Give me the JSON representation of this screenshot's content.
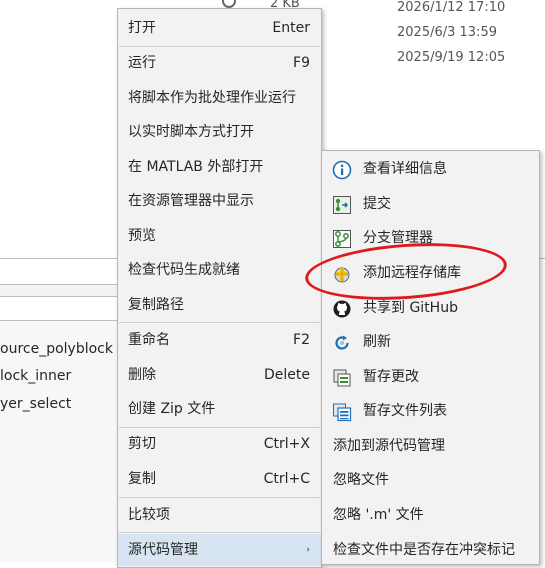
{
  "background": {
    "size_text": "2 KB",
    "dates": [
      "2026/1/12 17:10",
      "2025/6/3 13:59",
      "2025/9/19 12:05"
    ],
    "files": [
      "ource_polyblock",
      "lock_inner",
      "yer_select"
    ]
  },
  "context_menu": {
    "items": [
      {
        "label": "打开",
        "shortcut": "Enter"
      },
      {
        "label": "运行",
        "shortcut": "F9"
      },
      {
        "label": "将脚本作为批处理作业运行",
        "shortcut": ""
      },
      {
        "label": "以实时脚本方式打开",
        "shortcut": ""
      },
      {
        "label": "在 MATLAB 外部打开",
        "shortcut": ""
      },
      {
        "label": "在资源管理器中显示",
        "shortcut": ""
      },
      {
        "label": "预览",
        "shortcut": ""
      },
      {
        "label": "检查代码生成就绪",
        "shortcut": ""
      },
      {
        "label": "复制路径",
        "shortcut": ""
      },
      {
        "label": "重命名",
        "shortcut": "F2"
      },
      {
        "label": "删除",
        "shortcut": "Delete"
      },
      {
        "label": "创建 Zip 文件",
        "shortcut": ""
      },
      {
        "label": "剪切",
        "shortcut": "Ctrl+X"
      },
      {
        "label": "复制",
        "shortcut": "Ctrl+C"
      },
      {
        "label": "比较项",
        "shortcut": ""
      },
      {
        "label": "源代码管理",
        "shortcut": "",
        "submenu_arrow": "›"
      }
    ]
  },
  "source_control_submenu": {
    "items": [
      {
        "label": "查看详细信息",
        "icon": "info-icon"
      },
      {
        "label": "提交",
        "icon": "commit-icon"
      },
      {
        "label": "分支管理器",
        "icon": "branch-icon"
      },
      {
        "label": "添加远程存储库",
        "icon": "add-remote-icon"
      },
      {
        "label": "共享到 GitHub",
        "icon": "github-icon"
      },
      {
        "label": "刷新",
        "icon": "refresh-icon"
      },
      {
        "label": "暂存更改",
        "icon": "stash-icon"
      },
      {
        "label": "暂存文件列表",
        "icon": "stash-list-icon"
      },
      {
        "label": "添加到源代码管理",
        "icon": ""
      },
      {
        "label": "忽略文件",
        "icon": ""
      },
      {
        "label": "忽略 '.m' 文件",
        "icon": ""
      },
      {
        "label": "检查文件中是否存在冲突标记",
        "icon": ""
      }
    ]
  },
  "colors": {
    "menu_bg": "#f2f2f2",
    "active_item": "#d7e5f3",
    "annotation_red": "#e0191c",
    "icon_blue": "#1f6fb7",
    "icon_green": "#3a8f3a"
  }
}
